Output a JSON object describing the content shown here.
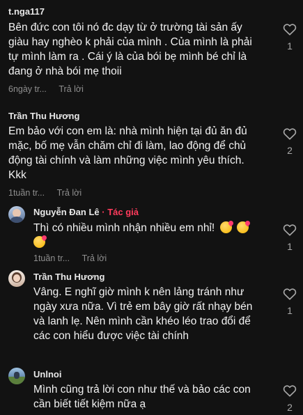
{
  "comments": [
    {
      "username": "t.nga117",
      "text_lines": [
        "Bên đức con tôi nó đc dạy từ ở trường tài sản ấy",
        "giàu hay nghèo k phải của mình . Của mình là phải",
        "tự mình làm ra . Cái ý là của bói bẹ mình bé chỉ là",
        "đang ở nhà bói mẹ thoii"
      ],
      "time": "6ngày tr...",
      "reply_label": "Trả lời",
      "likes": "1"
    },
    {
      "username": "Trần Thu Hương",
      "text_lines": [
        "Em bảo với con em là: nhà mình hiện tại đủ ăn đủ",
        "mặc, bố mẹ vẫn chăm chỉ đi làm, lao động để chủ",
        "động tài chính và làm những việc mình yêu thích.",
        "Kkk"
      ],
      "time": "1tuần tr...",
      "reply_label": "Trả lời",
      "likes": "2"
    }
  ],
  "replies": [
    {
      "username": "Nguyễn Đan Lê",
      "author_tag": "· Tác giả",
      "text_lines": [
        "Thì có nhiều mình nhận nhiều em nhỉ!"
      ],
      "emojis": [
        "smiling-face-with-hearts",
        "smiling-face-with-hearts",
        "smiling-face-with-hearts"
      ],
      "time": "1tuần tr...",
      "reply_label": "Trả lời",
      "likes": "1"
    },
    {
      "username": "Trần Thu Hương",
      "text_lines": [
        "Vâng. E nghĩ giờ mình k nên lảng tránh như",
        "ngày xưa nữa. Vì trẻ em bây giờ rất nhạy bén",
        "và lanh lẹ. Nên mình cần khéo léo trao đổi để",
        "các con hiểu được việc tài chính"
      ],
      "time": "1tuần tr...",
      "reply_label": "Trả lời",
      "likes": "1"
    },
    {
      "username": "Unlnoi",
      "text_lines": [
        "Mình cũng trả lời con như thế và bảo các con",
        "cần biết tiết kiệm nữa ạ"
      ],
      "likes": "2"
    }
  ],
  "colors": {
    "background": "#121212",
    "author_tag": "#ff3b5c",
    "meta": "#8f8f8f"
  },
  "icons": {
    "like": "heart-outline-icon"
  }
}
